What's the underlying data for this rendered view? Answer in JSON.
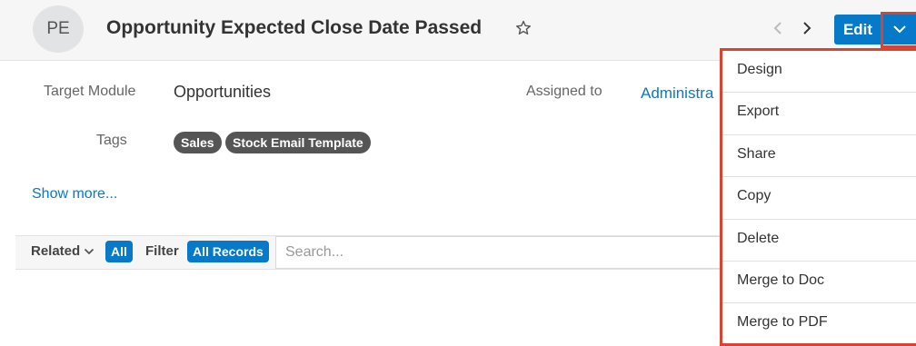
{
  "header": {
    "avatar_initials": "PE",
    "title": "Opportunity Expected Close Date Passed",
    "edit_label": "Edit"
  },
  "record": {
    "target_module_label": "Target Module",
    "target_module_value": "Opportunities",
    "assigned_to_label": "Assigned to",
    "assigned_to_value": "Administra",
    "tags_label": "Tags",
    "tags": [
      "Sales",
      "Stock Email Template"
    ],
    "show_more": "Show more..."
  },
  "related": {
    "related_label": "Related",
    "all_label": "All",
    "filter_label": "Filter",
    "all_records_label": "All Records",
    "search_placeholder": "Search..."
  },
  "menu": {
    "items": [
      "Design",
      "Export",
      "Share",
      "Copy",
      "Delete",
      "Merge to Doc",
      "Merge to PDF"
    ]
  },
  "colors": {
    "accent": "#0679c8",
    "highlight": "#d9432f",
    "tag_bg": "#555555",
    "header_bg": "#f6f6f6"
  },
  "icons": [
    "star-icon",
    "chevron-left-icon",
    "chevron-right-icon",
    "chevron-down-icon"
  ]
}
